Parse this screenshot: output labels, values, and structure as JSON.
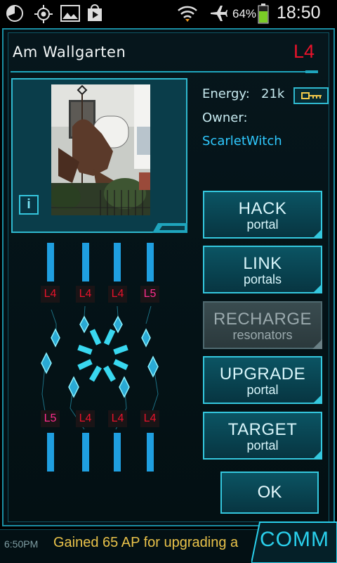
{
  "status_bar": {
    "battery_percent": "64%",
    "time": "18:50",
    "icons": [
      "pie-chart-icon",
      "gps-icon",
      "image-icon",
      "play-store-icon",
      "wifi-icon",
      "airplane-icon",
      "battery-icon"
    ]
  },
  "portal": {
    "name": "Am Wallgarten",
    "level": "L4",
    "info_button": "i",
    "energy_label": "Energy:",
    "energy_value": "21k",
    "owner_label": "Owner:",
    "owner_name": "ScarletWitch"
  },
  "actions": [
    {
      "main": "HACK",
      "sub": "portal",
      "enabled": true
    },
    {
      "main": "LINK",
      "sub": "portals",
      "enabled": true
    },
    {
      "main": "RECHARGE",
      "sub": "resonators",
      "enabled": false
    },
    {
      "main": "UPGRADE",
      "sub": "portal",
      "enabled": true
    },
    {
      "main": "TARGET",
      "sub": "portal",
      "enabled": true
    }
  ],
  "ok_label": "OK",
  "resonators": {
    "top": [
      "L4",
      "L4",
      "L4",
      "L5"
    ],
    "bottom": [
      "L5",
      "L4",
      "L4",
      "L4"
    ]
  },
  "colors": {
    "accent": "#2fb9cf",
    "level_red": "#e8132b",
    "level_pink": "#ff2d8e",
    "owner": "#2fc9ff",
    "ticker": "#e9c24a"
  },
  "bottom_bar": {
    "time": "6:50PM",
    "message": "Gained 65 AP for upgrading a",
    "comm_label": "COMM"
  }
}
